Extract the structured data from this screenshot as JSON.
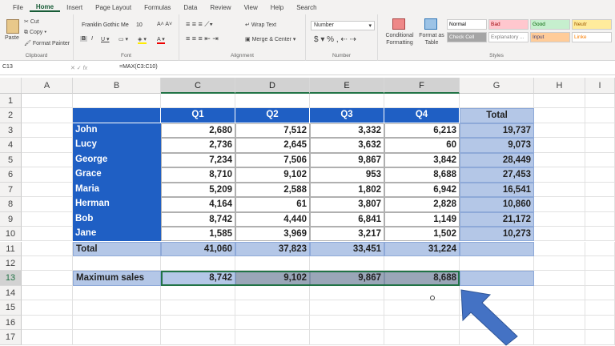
{
  "ribbon_tabs": [
    "File",
    "Home",
    "Insert",
    "Page Layout",
    "Formulas",
    "Data",
    "Review",
    "View",
    "Help",
    "Search"
  ],
  "active_tab": "Home",
  "clipboard": {
    "paste": "Paste",
    "cut": "Cut",
    "copy": "Copy",
    "format_painter": "Format Painter",
    "label": "Clipboard"
  },
  "font": {
    "name": "Franklin Gothic Me",
    "size": "10",
    "label": "Font"
  },
  "alignment": {
    "wrap": "Wrap Text",
    "merge": "Merge & Center",
    "label": "Alignment"
  },
  "number": {
    "format": "Number",
    "label": "Number",
    "currency": "$",
    "percent": "%",
    "comma": ","
  },
  "styles": {
    "conditional": "Conditional Formatting",
    "format_table": "Format as Table",
    "items": [
      {
        "label": "Normal",
        "bg": "#ffffff",
        "fg": "#000000"
      },
      {
        "label": "Bad",
        "bg": "#ffc7ce",
        "fg": "#9c0006"
      },
      {
        "label": "Good",
        "bg": "#c6efce",
        "fg": "#006100"
      },
      {
        "label": "Neutr",
        "bg": "#ffeb9c",
        "fg": "#9c5700"
      },
      {
        "label": "Check Cell",
        "bg": "#a5a5a5",
        "fg": "#ffffff"
      },
      {
        "label": "Explanatory ...",
        "bg": "#ffffff",
        "fg": "#7f7f7f"
      },
      {
        "label": "Input",
        "bg": "#ffcc99",
        "fg": "#3f3f76"
      },
      {
        "label": "Linke",
        "bg": "#ffffff",
        "fg": "#fa7d00"
      }
    ],
    "label": "Styles"
  },
  "formula_bar": {
    "name_box": "C13",
    "formula": "=MAX(C3:C10)"
  },
  "columns": [
    "A",
    "B",
    "C",
    "D",
    "E",
    "F",
    "G",
    "H",
    "I"
  ],
  "rows": [
    "1",
    "2",
    "3",
    "4",
    "5",
    "6",
    "7",
    "8",
    "9",
    "10",
    "11",
    "12",
    "13",
    "14",
    "15",
    "16",
    "17"
  ],
  "table": {
    "headers": [
      "Q1",
      "Q2",
      "Q3",
      "Q4",
      "Total"
    ],
    "data": [
      [
        "John",
        "2,680",
        "7,512",
        "3,332",
        "6,213",
        "19,737"
      ],
      [
        "Lucy",
        "2,736",
        "2,645",
        "3,632",
        "60",
        "9,073"
      ],
      [
        "George",
        "7,234",
        "7,506",
        "9,867",
        "3,842",
        "28,449"
      ],
      [
        "Grace",
        "8,710",
        "9,102",
        "953",
        "8,688",
        "27,453"
      ],
      [
        "Maria",
        "5,209",
        "2,588",
        "1,802",
        "6,942",
        "16,541"
      ],
      [
        "Herman",
        "4,164",
        "61",
        "3,807",
        "2,828",
        "10,860"
      ],
      [
        "Bob",
        "8,742",
        "4,440",
        "6,841",
        "1,149",
        "21,172"
      ],
      [
        "Jane",
        "1,585",
        "3,969",
        "3,217",
        "1,502",
        "10,273"
      ]
    ],
    "total_row": [
      "Total",
      "41,060",
      "37,823",
      "33,451",
      "31,224",
      ""
    ],
    "max_row": [
      "Maximum sales",
      "8,742",
      "9,102",
      "9,867",
      "8,688",
      ""
    ]
  },
  "colors": {
    "header_blue": "#1f5fc4",
    "total_blue": "#b4c7e7",
    "excel_green": "#217346",
    "arrow": "#4472c4"
  }
}
